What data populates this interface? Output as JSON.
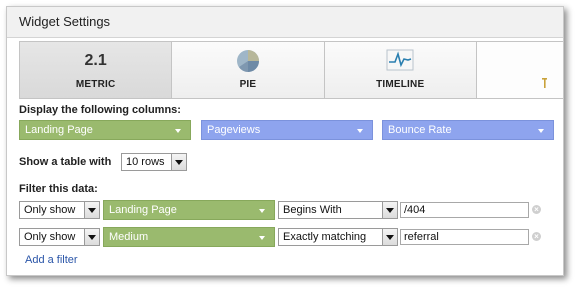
{
  "dialog": {
    "title": "Widget Settings"
  },
  "tabs": [
    {
      "label": "METRIC",
      "icon_text": "2.1",
      "icon": "metric-icon",
      "active": true
    },
    {
      "label": "PIE",
      "icon": "pie-chart-icon"
    },
    {
      "label": "TIMELINE",
      "icon": "timeline-icon"
    }
  ],
  "columns": {
    "label": "Display the following columns:",
    "items": [
      {
        "value": "Landing Page",
        "color": "#9aba6e"
      },
      {
        "value": "Pageviews",
        "color": "#8ea4ee"
      },
      {
        "value": "Bounce Rate",
        "color": "#8ea4ee"
      }
    ]
  },
  "table": {
    "label": "Show a table with",
    "rows_value": "10 rows"
  },
  "filter": {
    "label": "Filter this data:",
    "rows": [
      {
        "mode": "Only show",
        "dimension": "Landing Page",
        "match": "Begins With",
        "value": "/404"
      },
      {
        "mode": "Only show",
        "dimension": "Medium",
        "match": "Exactly matching",
        "value": "referral"
      }
    ],
    "add_label": "Add a filter"
  }
}
